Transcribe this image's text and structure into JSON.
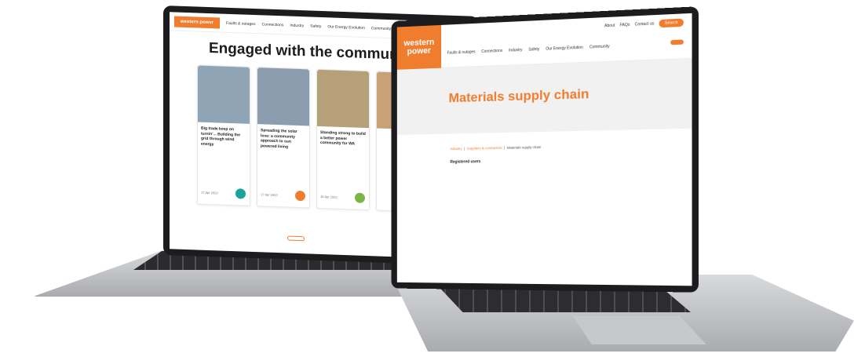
{
  "left_laptop": {
    "nav": {
      "logo": "western power",
      "items": [
        "Faults & outages",
        "Connections",
        "Industry",
        "Safety",
        "Our Energy Evolution",
        "Community"
      ]
    },
    "title": "Engaged with the communities we oper",
    "cards": [
      {
        "tag": "",
        "text": "Big trade keep on turnin’... Building the grid through wind energy",
        "sub": "",
        "date": "17 Apr 2023",
        "img_color": "#8fa5b5",
        "btn_color": "#1aa39a"
      },
      {
        "tag": "",
        "text": "Spreading the solar love: a community approach to sun powered living",
        "sub": "",
        "date": "17 Apr 2023",
        "img_color": "#8c9db0",
        "btn_color": "#f07d2e"
      },
      {
        "tag": "",
        "text": "Standing strong to build a better power community for WA",
        "sub": "",
        "date": "18 Apr 2023",
        "img_color": "#b5a07a",
        "btn_color": "#7ab648"
      },
      {
        "tag": "",
        "text": "",
        "sub": "",
        "date": "",
        "img_color": "#c8a277",
        "btn_color": ""
      }
    ],
    "load_more": ""
  },
  "right_laptop": {
    "logo": "western power",
    "alert": "",
    "top_links": [
      "About",
      "FAQs",
      "Contact us"
    ],
    "search_label": "Search",
    "nav": [
      "Faults & outages",
      "Connections",
      "Industry",
      "Safety",
      "Our Energy Evolution",
      "Community"
    ],
    "cta": "",
    "hero_title": "Materials supply chain",
    "breadcrumb": [
      "Industry",
      "Suppliers & contractors",
      "Materials supply chain"
    ],
    "paragraphs": [
      "",
      "",
      ""
    ],
    "subheading": "Registered users",
    "links": [
      "",
      ""
    ]
  }
}
